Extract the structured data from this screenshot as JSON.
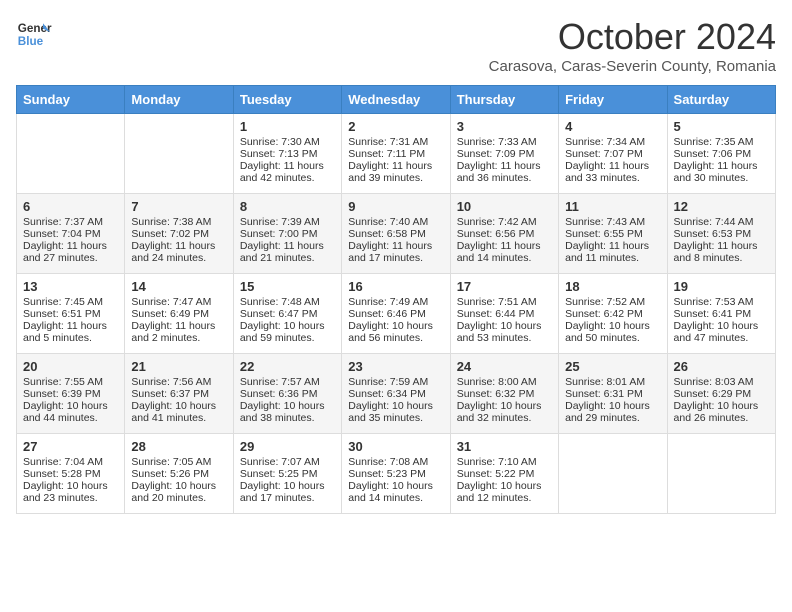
{
  "header": {
    "logo_line1": "General",
    "logo_line2": "Blue",
    "month": "October 2024",
    "location": "Carasova, Caras-Severin County, Romania"
  },
  "weekdays": [
    "Sunday",
    "Monday",
    "Tuesday",
    "Wednesday",
    "Thursday",
    "Friday",
    "Saturday"
  ],
  "weeks": [
    [
      {
        "day": "",
        "sunrise": "",
        "sunset": "",
        "daylight": ""
      },
      {
        "day": "",
        "sunrise": "",
        "sunset": "",
        "daylight": ""
      },
      {
        "day": "1",
        "sunrise": "Sunrise: 7:30 AM",
        "sunset": "Sunset: 7:13 PM",
        "daylight": "Daylight: 11 hours and 42 minutes."
      },
      {
        "day": "2",
        "sunrise": "Sunrise: 7:31 AM",
        "sunset": "Sunset: 7:11 PM",
        "daylight": "Daylight: 11 hours and 39 minutes."
      },
      {
        "day": "3",
        "sunrise": "Sunrise: 7:33 AM",
        "sunset": "Sunset: 7:09 PM",
        "daylight": "Daylight: 11 hours and 36 minutes."
      },
      {
        "day": "4",
        "sunrise": "Sunrise: 7:34 AM",
        "sunset": "Sunset: 7:07 PM",
        "daylight": "Daylight: 11 hours and 33 minutes."
      },
      {
        "day": "5",
        "sunrise": "Sunrise: 7:35 AM",
        "sunset": "Sunset: 7:06 PM",
        "daylight": "Daylight: 11 hours and 30 minutes."
      }
    ],
    [
      {
        "day": "6",
        "sunrise": "Sunrise: 7:37 AM",
        "sunset": "Sunset: 7:04 PM",
        "daylight": "Daylight: 11 hours and 27 minutes."
      },
      {
        "day": "7",
        "sunrise": "Sunrise: 7:38 AM",
        "sunset": "Sunset: 7:02 PM",
        "daylight": "Daylight: 11 hours and 24 minutes."
      },
      {
        "day": "8",
        "sunrise": "Sunrise: 7:39 AM",
        "sunset": "Sunset: 7:00 PM",
        "daylight": "Daylight: 11 hours and 21 minutes."
      },
      {
        "day": "9",
        "sunrise": "Sunrise: 7:40 AM",
        "sunset": "Sunset: 6:58 PM",
        "daylight": "Daylight: 11 hours and 17 minutes."
      },
      {
        "day": "10",
        "sunrise": "Sunrise: 7:42 AM",
        "sunset": "Sunset: 6:56 PM",
        "daylight": "Daylight: 11 hours and 14 minutes."
      },
      {
        "day": "11",
        "sunrise": "Sunrise: 7:43 AM",
        "sunset": "Sunset: 6:55 PM",
        "daylight": "Daylight: 11 hours and 11 minutes."
      },
      {
        "day": "12",
        "sunrise": "Sunrise: 7:44 AM",
        "sunset": "Sunset: 6:53 PM",
        "daylight": "Daylight: 11 hours and 8 minutes."
      }
    ],
    [
      {
        "day": "13",
        "sunrise": "Sunrise: 7:45 AM",
        "sunset": "Sunset: 6:51 PM",
        "daylight": "Daylight: 11 hours and 5 minutes."
      },
      {
        "day": "14",
        "sunrise": "Sunrise: 7:47 AM",
        "sunset": "Sunset: 6:49 PM",
        "daylight": "Daylight: 11 hours and 2 minutes."
      },
      {
        "day": "15",
        "sunrise": "Sunrise: 7:48 AM",
        "sunset": "Sunset: 6:47 PM",
        "daylight": "Daylight: 10 hours and 59 minutes."
      },
      {
        "day": "16",
        "sunrise": "Sunrise: 7:49 AM",
        "sunset": "Sunset: 6:46 PM",
        "daylight": "Daylight: 10 hours and 56 minutes."
      },
      {
        "day": "17",
        "sunrise": "Sunrise: 7:51 AM",
        "sunset": "Sunset: 6:44 PM",
        "daylight": "Daylight: 10 hours and 53 minutes."
      },
      {
        "day": "18",
        "sunrise": "Sunrise: 7:52 AM",
        "sunset": "Sunset: 6:42 PM",
        "daylight": "Daylight: 10 hours and 50 minutes."
      },
      {
        "day": "19",
        "sunrise": "Sunrise: 7:53 AM",
        "sunset": "Sunset: 6:41 PM",
        "daylight": "Daylight: 10 hours and 47 minutes."
      }
    ],
    [
      {
        "day": "20",
        "sunrise": "Sunrise: 7:55 AM",
        "sunset": "Sunset: 6:39 PM",
        "daylight": "Daylight: 10 hours and 44 minutes."
      },
      {
        "day": "21",
        "sunrise": "Sunrise: 7:56 AM",
        "sunset": "Sunset: 6:37 PM",
        "daylight": "Daylight: 10 hours and 41 minutes."
      },
      {
        "day": "22",
        "sunrise": "Sunrise: 7:57 AM",
        "sunset": "Sunset: 6:36 PM",
        "daylight": "Daylight: 10 hours and 38 minutes."
      },
      {
        "day": "23",
        "sunrise": "Sunrise: 7:59 AM",
        "sunset": "Sunset: 6:34 PM",
        "daylight": "Daylight: 10 hours and 35 minutes."
      },
      {
        "day": "24",
        "sunrise": "Sunrise: 8:00 AM",
        "sunset": "Sunset: 6:32 PM",
        "daylight": "Daylight: 10 hours and 32 minutes."
      },
      {
        "day": "25",
        "sunrise": "Sunrise: 8:01 AM",
        "sunset": "Sunset: 6:31 PM",
        "daylight": "Daylight: 10 hours and 29 minutes."
      },
      {
        "day": "26",
        "sunrise": "Sunrise: 8:03 AM",
        "sunset": "Sunset: 6:29 PM",
        "daylight": "Daylight: 10 hours and 26 minutes."
      }
    ],
    [
      {
        "day": "27",
        "sunrise": "Sunrise: 7:04 AM",
        "sunset": "Sunset: 5:28 PM",
        "daylight": "Daylight: 10 hours and 23 minutes."
      },
      {
        "day": "28",
        "sunrise": "Sunrise: 7:05 AM",
        "sunset": "Sunset: 5:26 PM",
        "daylight": "Daylight: 10 hours and 20 minutes."
      },
      {
        "day": "29",
        "sunrise": "Sunrise: 7:07 AM",
        "sunset": "Sunset: 5:25 PM",
        "daylight": "Daylight: 10 hours and 17 minutes."
      },
      {
        "day": "30",
        "sunrise": "Sunrise: 7:08 AM",
        "sunset": "Sunset: 5:23 PM",
        "daylight": "Daylight: 10 hours and 14 minutes."
      },
      {
        "day": "31",
        "sunrise": "Sunrise: 7:10 AM",
        "sunset": "Sunset: 5:22 PM",
        "daylight": "Daylight: 10 hours and 12 minutes."
      },
      {
        "day": "",
        "sunrise": "",
        "sunset": "",
        "daylight": ""
      },
      {
        "day": "",
        "sunrise": "",
        "sunset": "",
        "daylight": ""
      }
    ]
  ]
}
